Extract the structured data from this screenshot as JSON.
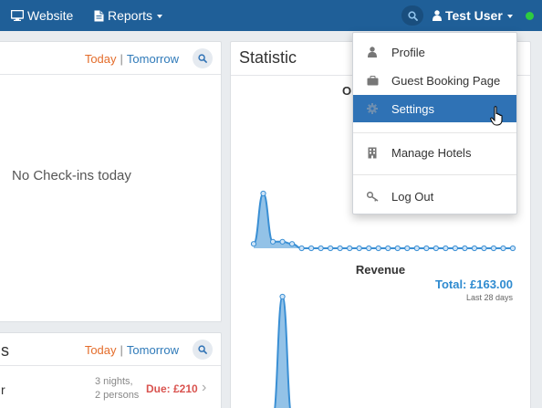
{
  "topbar": {
    "website_label": "Website",
    "reports_label": "Reports",
    "user_label": "Test User"
  },
  "checkins": {
    "today_label": "Today",
    "separator": "|",
    "tomorrow_label": "Tomorrow",
    "empty_message": "No Check-ins today"
  },
  "checkouts": {
    "title_fragment": "s",
    "today_label": "Today",
    "separator": "|",
    "tomorrow_label": "Tomorrow",
    "rows": [
      {
        "guest_fragment": "r",
        "nights": "3 nights,",
        "persons": "2 persons",
        "due": "Due: £210",
        "chevron": "›"
      }
    ]
  },
  "statistic": {
    "title": "Statistic",
    "occupancy_label_fragment": "O",
    "revenue_label": "Revenue",
    "revenue_total": "Total: £163.00",
    "revenue_period": "Last 28 days"
  },
  "user_menu": {
    "items": [
      {
        "label": "Profile",
        "icon": "user-icon"
      },
      {
        "label": "Guest Booking Page",
        "icon": "briefcase-icon"
      },
      {
        "label": "Settings",
        "icon": "gear-icon",
        "active": true
      },
      {
        "label": "Manage Hotels",
        "icon": "building-icon"
      },
      {
        "label": "Log Out",
        "icon": "key-icon"
      }
    ]
  },
  "colors": {
    "topbar": "#1f5f98",
    "accent": "#2f72b5",
    "today": "#e46d2b",
    "due": "#d9534f",
    "chart_line": "#3a8fd4",
    "status_online": "#2ecc40"
  },
  "chart_data": [
    {
      "type": "area",
      "title": "O",
      "series": [
        {
          "values": [
            2,
            25,
            3,
            3,
            2,
            0,
            0,
            0,
            0,
            0,
            0,
            0,
            0,
            0,
            0,
            0,
            0,
            0,
            0,
            0,
            0,
            0,
            0,
            0,
            0,
            0,
            0,
            0
          ]
        }
      ]
    },
    {
      "type": "area",
      "title": "Revenue",
      "series": [
        {
          "values": [
            0,
            0,
            0,
            163,
            0,
            0,
            0,
            0,
            0,
            0,
            0,
            0,
            0,
            0,
            0,
            0,
            0,
            0,
            0,
            0,
            0,
            0,
            0,
            0,
            0,
            0,
            0,
            0
          ]
        }
      ]
    }
  ]
}
